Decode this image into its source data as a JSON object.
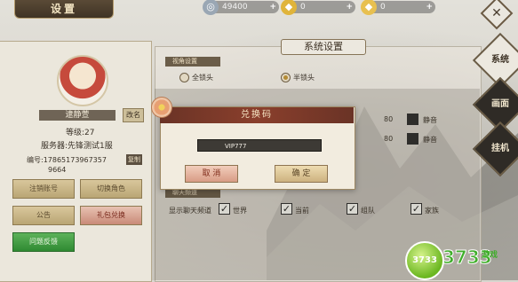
{
  "header": {
    "title": "设置",
    "resources": [
      {
        "icon": "silver-coin-icon",
        "value": "49400"
      },
      {
        "icon": "gold-ingot-icon",
        "value": "0"
      },
      {
        "icon": "gold-ingot-bound-icon",
        "value": "0"
      }
    ],
    "close_label": "✕"
  },
  "profile": {
    "name": "逮静萱",
    "rename_label": "改名",
    "level": "等级:27",
    "server": "服务器:先锋测试1服",
    "id_line1": "编号:17865173967357",
    "id_line2": "9664",
    "copy_label": "复制",
    "buttons": {
      "logout": "注销账号",
      "switch_role": "切换角色",
      "notice": "公告",
      "gift_code": "礼包兑换",
      "feedback": "问题反馈"
    }
  },
  "settings": {
    "title": "系统设置",
    "section_camera": "视角设置",
    "camera_options": [
      "全锁头",
      "半锁头"
    ],
    "camera_selected": 1,
    "volume_value_1": "80",
    "volume_value_2": "80",
    "mute_label_1": "静音",
    "mute_label_2": "静音",
    "section_chat": "聊天频道",
    "chat_row_label": "显示聊天频道",
    "chat_channels": [
      "世界",
      "当前",
      "组队",
      "家族"
    ]
  },
  "side_tabs": [
    "系统",
    "画面",
    "挂机"
  ],
  "redeem_dialog": {
    "title": "兑换码",
    "code_value": "VIP777",
    "cancel_label": "取 消",
    "confirm_label": "确 定"
  },
  "watermark": {
    "ball_text": "3733",
    "text": "3733",
    "sub": "游戏"
  }
}
